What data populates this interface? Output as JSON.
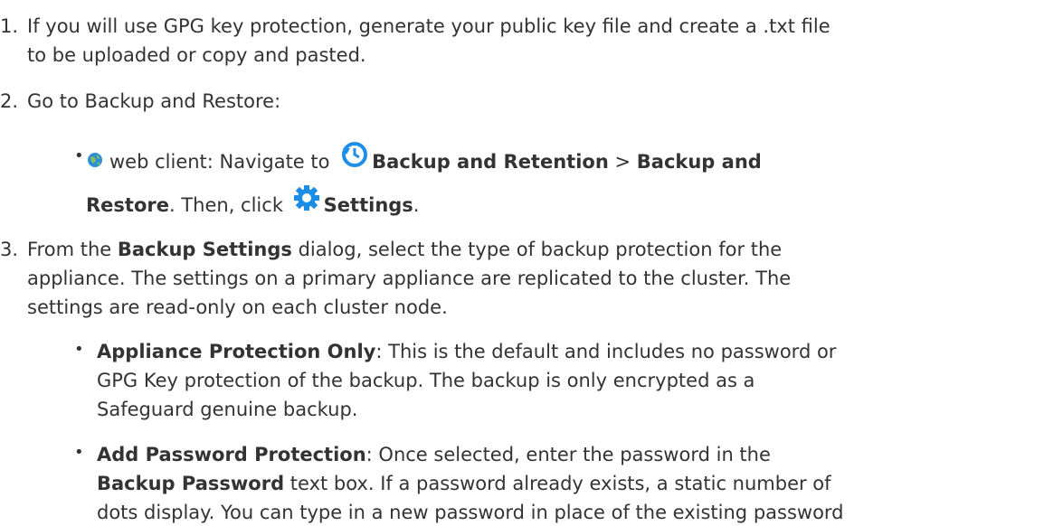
{
  "steps": [
    {
      "number": "1.",
      "line1": "If you will use GPG key protection, generate your public key file and create a .txt file",
      "line2": "to be uploaded or copy and pasted."
    },
    {
      "number": "2.",
      "text": "Go to Backup and Restore:",
      "bullet": {
        "client": "web client: Navigate to",
        "link1": "Backup and Retention",
        "sep": ">",
        "link2_part1": "Backup and",
        "link2_part2": "Restore",
        "after": ". Then, click",
        "settings": "Settings",
        "end": "."
      }
    },
    {
      "number": "3.",
      "prefix": "From the",
      "dialog_name": "Backup Settings",
      "line1_rest": "dialog, select the type of backup protection for the",
      "line2": "appliance. The settings on a primary appliance are replicated to the cluster. The",
      "line3": "settings are read-only on each cluster node.",
      "options": [
        {
          "name": "Appliance Protection Only",
          "line1_rest": ": This is the default and includes no password or",
          "line2": "GPG Key protection of the backup. The backup is only encrypted as a",
          "line3": "Safeguard genuine backup."
        },
        {
          "name": "Add Password Protection",
          "line1_rest": ": Once selected, enter the password in the",
          "field_name": "Backup Password",
          "line2_rest": "text box. If a password already exists, a static number of",
          "line3": "dots display. You can type in a new password in place of the existing password"
        }
      ]
    }
  ],
  "icons": {
    "globe": "globe-icon",
    "backup_retention": "backup-clock-icon",
    "settings": "gear-icon"
  },
  "colors": {
    "text": "#333333",
    "globe_blue": "#2e8fd6",
    "clock_blue": "#1f8ee8",
    "gear_blue": "#1c8de6"
  }
}
